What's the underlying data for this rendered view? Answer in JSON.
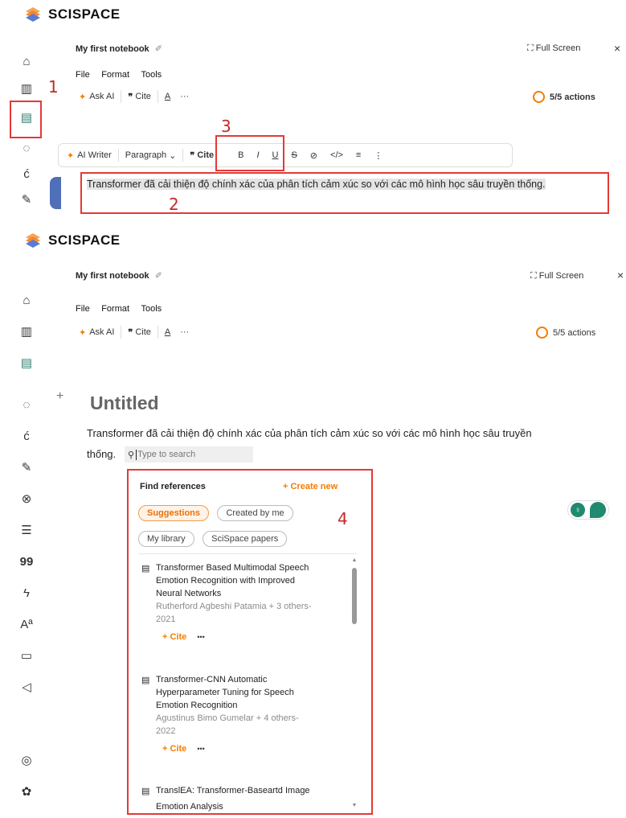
{
  "brand": {
    "name": "SCISPACE",
    "color": "#f58220"
  },
  "top": {
    "notebook_title": "My first notebook",
    "fullscreen": "Full Screen",
    "close": "×",
    "menu": [
      "File",
      "Format",
      "Tools"
    ],
    "toolbar": {
      "ask_ai": "Ask AI",
      "cite": "Cite",
      "font": "A",
      "more": "···"
    },
    "actions": "5/5 actions",
    "floating_toolbar": {
      "ai_writer": "AI Writer",
      "paragraph": "Paragraph",
      "cite": "Cite",
      "bold": "B",
      "italic": "I",
      "underline": "U",
      "strike": "S",
      "link": "⊘",
      "code": "</>",
      "list": "≡",
      "more": "⋮"
    },
    "selected_text": "Transformer đã cải thiện độ chính xác của phân tích cảm xúc so với các mô hình học sâu truyền thống.",
    "annotations": [
      "1",
      "2",
      "3"
    ]
  },
  "bottom": {
    "notebook_title": "My first notebook",
    "fullscreen": "Full Screen",
    "close": "×",
    "menu": [
      "File",
      "Format",
      "Tools"
    ],
    "toolbar": {
      "ask_ai": "Ask AI",
      "cite": "Cite",
      "font": "A",
      "more": "···"
    },
    "actions": "5/5 actions",
    "add": "+",
    "doc_title": "Untitled",
    "body_line1": "Transformer đã cải thiện độ chính xác của phân tích cảm xúc so với các mô hình học sâu truyền",
    "body_line2": "thống.",
    "search_placeholder": "Type to search",
    "annotation": "4",
    "panel": {
      "title": "Find references",
      "create_new": "+  Create new",
      "tabs": [
        "Suggestions",
        "Created by me",
        "My library",
        "SciSpace papers"
      ],
      "refs": [
        {
          "title_lines": [
            "Transformer Based Multimodal Speech",
            "Emotion Recognition with Improved",
            "Neural Networks"
          ],
          "author": "Rutherford Agbeshi Patamia + 3 others-",
          "year": "2021",
          "cite": "+ Cite",
          "more": "•••"
        },
        {
          "title_lines": [
            "Transformer-CNN Automatic",
            "Hyperparameter Tuning for Speech",
            "Emotion Recognition"
          ],
          "author": "Agustinus Bimo Gumelar + 4 others-",
          "year": "2022",
          "cite": "+ Cite",
          "more": "•••"
        },
        {
          "title_lines": [
            "TranslEA: Transformer-Baseartd Image",
            "Emotion Analysis"
          ],
          "author": "",
          "year": "",
          "cite": "",
          "more": ""
        }
      ]
    }
  },
  "sidebar_top_icons": [
    "home-icon",
    "library-icon",
    "notebook-icon",
    "chat-icon",
    "citation-gen-icon",
    "paraphraser-icon"
  ],
  "sidebar_bottom_icons": [
    "home-icon",
    "library-icon",
    "notebook-icon",
    "chat-icon",
    "citation-gen-icon",
    "paraphraser-icon",
    "extract-icon",
    "summarizer-icon",
    "quote-icon",
    "ai-detector-icon",
    "translate-icon",
    "video-icon",
    "announcement-icon",
    "apple-icon",
    "chrome-icon",
    "openai-icon"
  ]
}
